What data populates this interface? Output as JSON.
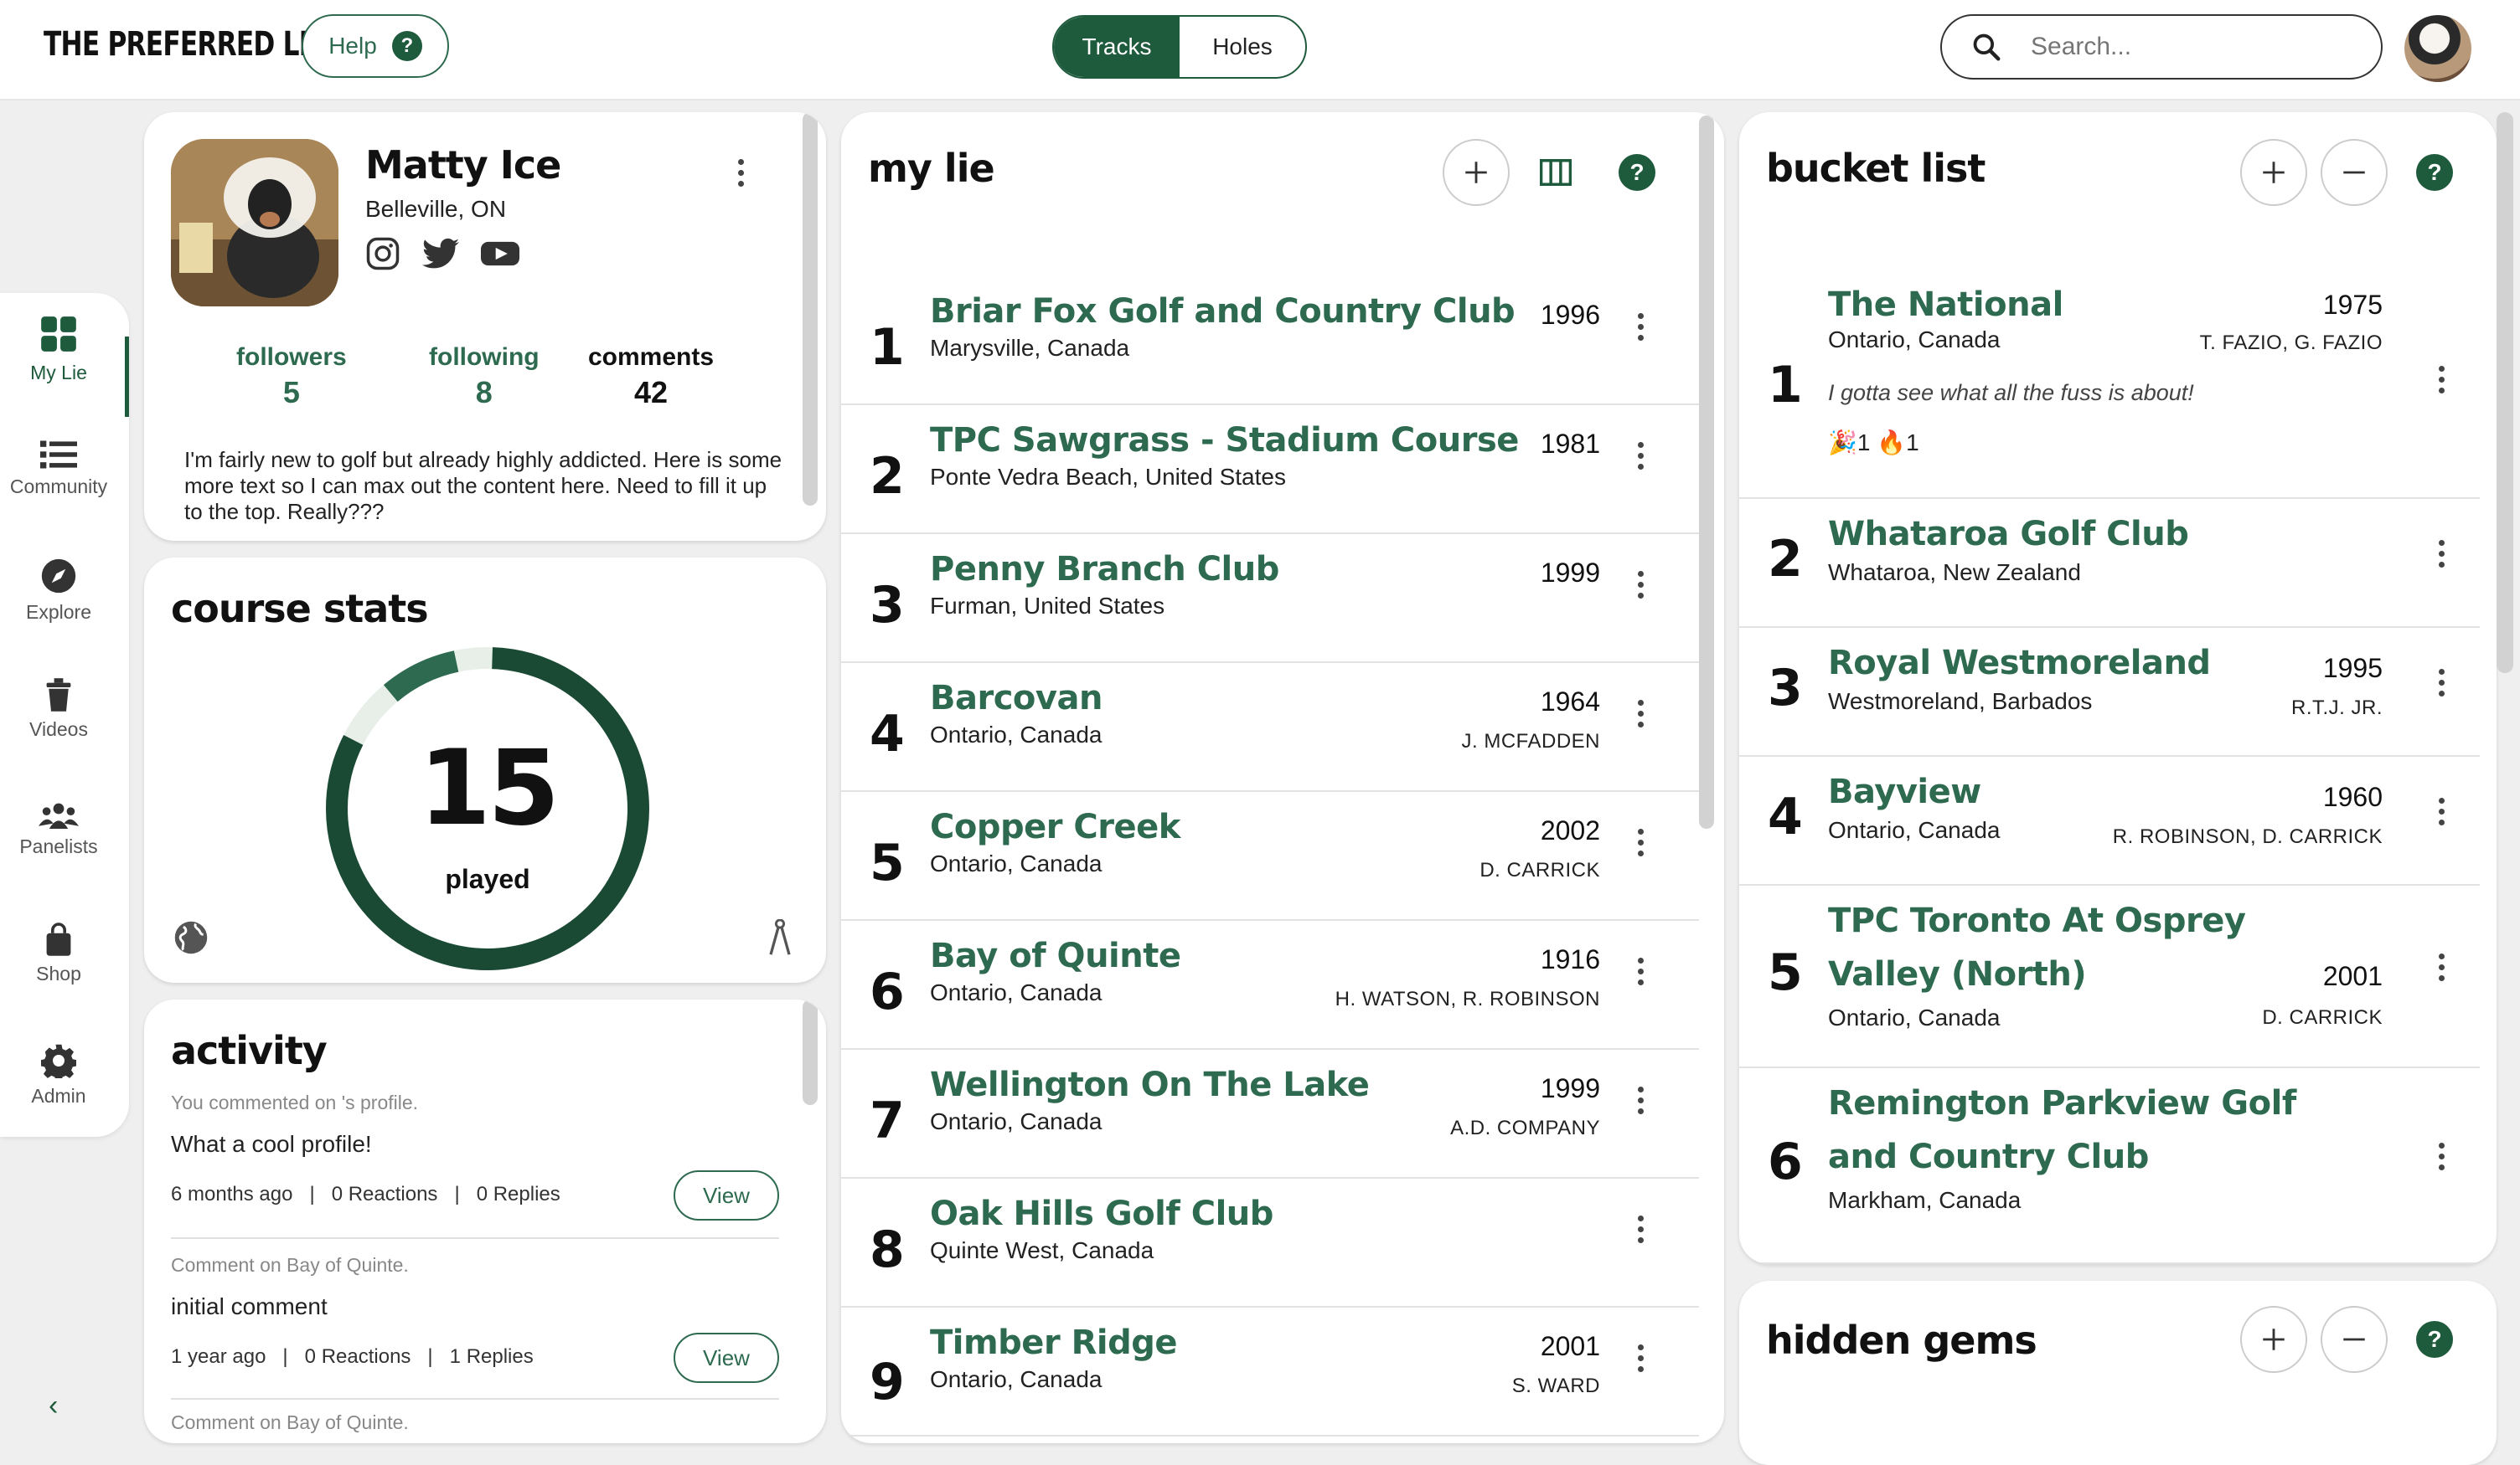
{
  "app": {
    "brand": "THE PREFERRED LIE",
    "help_label": "Help"
  },
  "header": {
    "toggle": [
      "Tracks",
      "Holes"
    ],
    "active_toggle": "Tracks",
    "search_placeholder": "Search..."
  },
  "nav": {
    "items": [
      {
        "label": "My Lie",
        "icon": "grid-icon",
        "active": true
      },
      {
        "label": "Community",
        "icon": "list-icon"
      },
      {
        "label": "Explore",
        "icon": "compass-icon"
      },
      {
        "label": "Videos",
        "icon": "trash-icon"
      },
      {
        "label": "Panelists",
        "icon": "people-icon"
      },
      {
        "label": "Shop",
        "icon": "bag-icon"
      },
      {
        "label": "Admin",
        "icon": "gear-icon"
      }
    ]
  },
  "profile": {
    "name": "Matty Ice",
    "location": "Belleville, ON",
    "socials": [
      "instagram-icon",
      "twitter-icon",
      "youtube-icon"
    ],
    "followers_label": "followers",
    "followers": "5",
    "following_label": "following",
    "following": "8",
    "comments_label": "comments",
    "comments": "42",
    "bio": "I'm fairly new to golf but already highly addicted. Here is some more text so I can max out the content here. Need to fill it up to the top. Really???"
  },
  "course_stats": {
    "title": "course stats",
    "played": "15",
    "played_label": "played",
    "progress_fraction": 0.94
  },
  "activity": {
    "title": "activity",
    "items": [
      {
        "meta": "You commented on 's profile.",
        "body": "What a cool profile!",
        "age": "6 months ago",
        "reactions": "0 Reactions",
        "replies": "0 Replies",
        "view": "View"
      },
      {
        "meta": "Comment on Bay of Quinte.",
        "body": "initial comment",
        "age": "1 year ago",
        "reactions": "0 Reactions",
        "replies": "1 Replies",
        "view": "View"
      },
      {
        "meta": "Comment on Bay of Quinte."
      }
    ]
  },
  "my_lie": {
    "title": "my lie",
    "rows": [
      {
        "rank": "1",
        "name": "Briar Fox Golf and Country Club",
        "location": "Marysville, Canada",
        "year": "1996",
        "architect": ""
      },
      {
        "rank": "2",
        "name": "TPC Sawgrass - Stadium Course",
        "location": "Ponte Vedra Beach, United States",
        "year": "1981",
        "architect": ""
      },
      {
        "rank": "3",
        "name": "Penny Branch Club",
        "location": "Furman, United States",
        "year": "1999",
        "architect": ""
      },
      {
        "rank": "4",
        "name": "Barcovan",
        "location": "Ontario, Canada",
        "year": "1964",
        "architect": "J. MCFADDEN"
      },
      {
        "rank": "5",
        "name": "Copper Creek",
        "location": "Ontario, Canada",
        "year": "2002",
        "architect": "D. CARRICK"
      },
      {
        "rank": "6",
        "name": "Bay of Quinte",
        "location": "Ontario, Canada",
        "year": "1916",
        "architect": "H. WATSON, R. ROBINSON"
      },
      {
        "rank": "7",
        "name": "Wellington On The Lake",
        "location": "Ontario, Canada",
        "year": "1999",
        "architect": "A.D. COMPANY"
      },
      {
        "rank": "8",
        "name": "Oak Hills Golf Club",
        "location": "Quinte West, Canada",
        "year": "",
        "architect": ""
      },
      {
        "rank": "9",
        "name": "Timber Ridge",
        "location": "Ontario, Canada",
        "year": "2001",
        "architect": "S. WARD"
      }
    ]
  },
  "bucket_list": {
    "title": "bucket list",
    "rows": [
      {
        "rank": "1",
        "name": "The National",
        "location": "Ontario, Canada",
        "year": "1975",
        "architect": "T. FAZIO, G. FAZIO",
        "note": "I gotta see what all the fuss is about!",
        "reactions": "🎉1 🔥1"
      },
      {
        "rank": "2",
        "name": "Whataroa Golf Club",
        "location": "Whataroa, New Zealand",
        "year": "",
        "architect": ""
      },
      {
        "rank": "3",
        "name": "Royal Westmoreland",
        "location": "Westmoreland, Barbados",
        "year": "1995",
        "architect": "R.T.J. JR."
      },
      {
        "rank": "4",
        "name": "Bayview",
        "location": "Ontario, Canada",
        "year": "1960",
        "architect": "R. ROBINSON, D. CARRICK"
      },
      {
        "rank": "5",
        "name": "TPC Toronto At Osprey Valley (North)",
        "location": "Ontario, Canada",
        "year": "2001",
        "architect": "D. CARRICK"
      },
      {
        "rank": "6",
        "name": "Remington Parkview Golf and Country Club",
        "location": "Markham, Canada",
        "year": "",
        "architect": ""
      }
    ]
  },
  "hidden_gems": {
    "title": "hidden gems"
  },
  "colors": {
    "accent": "#1e5a3c",
    "link": "#2d6a4f",
    "background": "#efefef"
  }
}
